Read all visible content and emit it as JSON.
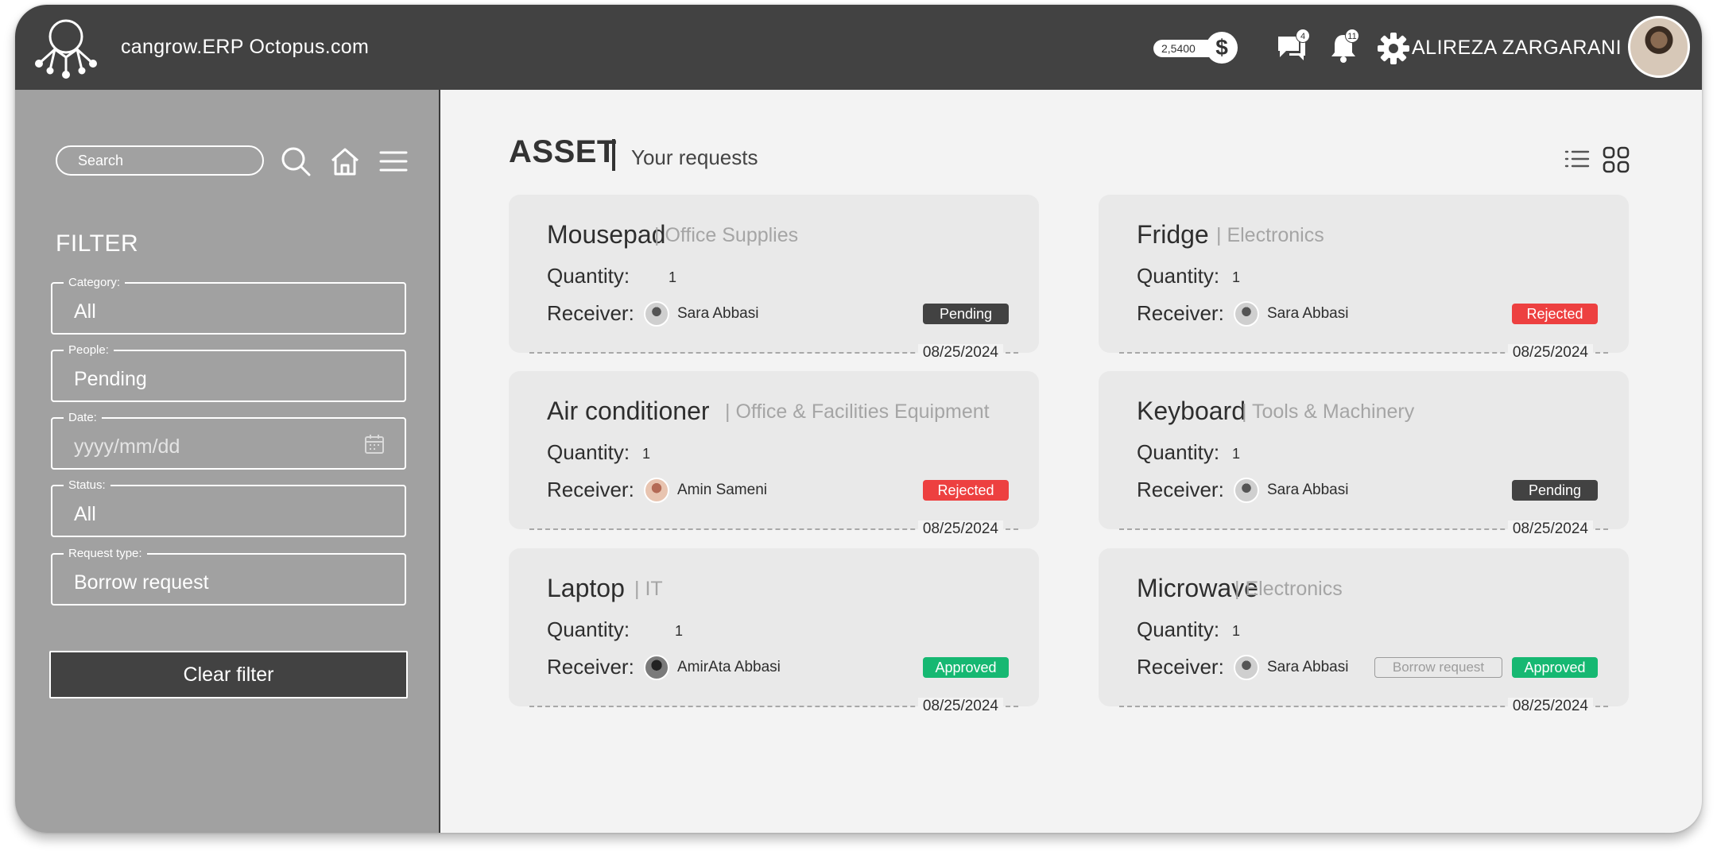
{
  "header": {
    "app_title": "cangrow.ERP Octopus.com",
    "coins": "2,5400",
    "coin_symbol": "$",
    "messages_count": "4",
    "notifications_count": "11",
    "username": "ALIREZA ZARGARANI"
  },
  "sidebar": {
    "search_placeholder": "Search",
    "filter_title": "FILTER",
    "fields": [
      {
        "label": "Category:",
        "value": "All"
      },
      {
        "label": "People:",
        "value": "Pending"
      },
      {
        "label": "Date:",
        "value": "yyyy/mm/dd"
      },
      {
        "label": "Status:",
        "value": "All"
      },
      {
        "label": "Request type:",
        "value": "Borrow request"
      }
    ],
    "clear_label": "Clear filter"
  },
  "main": {
    "title": "ASSET",
    "subtitle": "Your requests",
    "quantity_label": "Quantity:",
    "receiver_label": "Receiver:",
    "cards": [
      {
        "name": "Mousepad",
        "category": "Office Supplies",
        "quantity": "1",
        "receiver": "Sara Abbasi",
        "status": "Pending",
        "status_color": "#424242",
        "date": "08/25/2024"
      },
      {
        "name": "Fridge",
        "category": "Electronics",
        "quantity": "1",
        "receiver": "Sara Abbasi",
        "status": "Rejected",
        "status_color": "#ed4040",
        "date": "08/25/2024"
      },
      {
        "name": "Air conditioner",
        "category": "Office & Facilities Equipment",
        "quantity": "1",
        "receiver": "Amin Sameni",
        "status": "Rejected",
        "status_color": "#ed4040",
        "date": "08/25/2024"
      },
      {
        "name": "Keyboard",
        "category": "Tools & Machinery",
        "quantity": "1",
        "receiver": "Sara Abbasi",
        "status": "Pending",
        "status_color": "#424242",
        "date": "08/25/2024"
      },
      {
        "name": "Laptop",
        "category": "IT",
        "quantity": "1",
        "receiver": "AmirAta Abbasi",
        "status": "Approved",
        "status_color": "#16b872",
        "date": "08/25/2024"
      },
      {
        "name": "Microwave",
        "category": "Electronics",
        "quantity": "1",
        "receiver": "Sara Abbasi",
        "request_type": "Borrow request",
        "status": "Approved",
        "status_color": "#16b872",
        "date": "08/25/2024"
      }
    ]
  },
  "colors": {
    "topbar": "#424242",
    "sidebar": "#a1a1a1",
    "main_bg": "#f3f3f3",
    "card_bg": "#e9e9e9"
  }
}
